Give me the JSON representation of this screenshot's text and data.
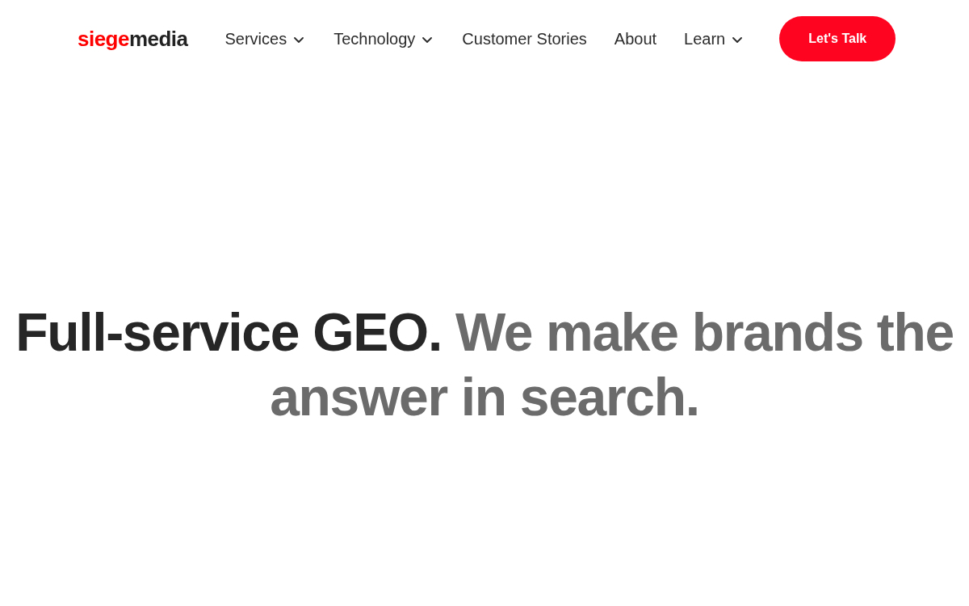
{
  "logo": {
    "accent": "siege",
    "text": "media"
  },
  "nav": [
    {
      "label": "Services",
      "has_menu": true
    },
    {
      "label": "Technology",
      "has_menu": true
    },
    {
      "label": "Customer Stories",
      "has_menu": false
    },
    {
      "label": "About",
      "has_menu": false
    },
    {
      "label": "Learn",
      "has_menu": true
    }
  ],
  "cta": {
    "label": "Let's Talk"
  },
  "headline": {
    "lead": "Full-service GEO.",
    "rest": "We make brands the answer in search."
  }
}
